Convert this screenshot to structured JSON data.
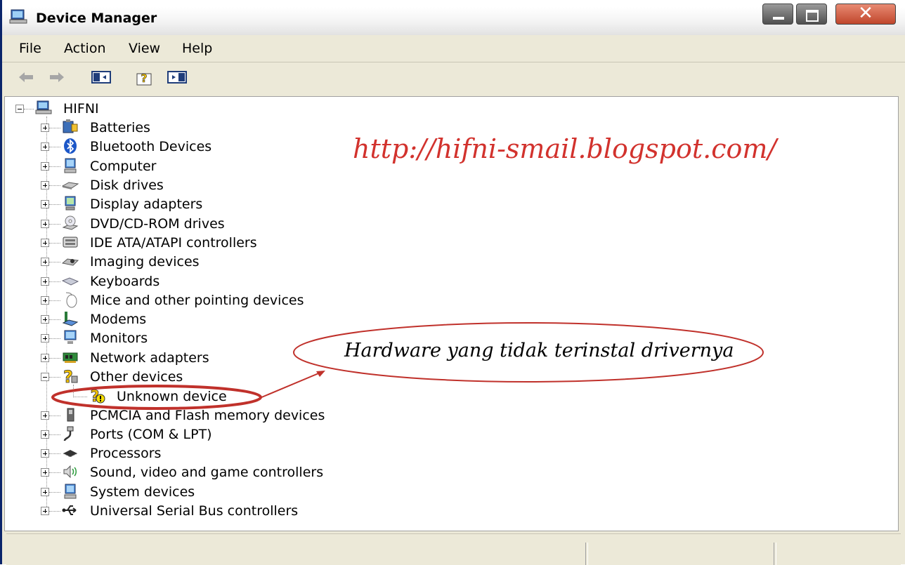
{
  "window": {
    "title": "Device Manager",
    "close_glyph": "✕"
  },
  "menu": [
    "File",
    "Action",
    "View",
    "Help"
  ],
  "toolbar": {
    "icons": [
      "back-arrow-icon",
      "forward-arrow-icon",
      "console-tree-icon",
      "help-icon",
      "action-pane-icon"
    ]
  },
  "tree": {
    "root": "HIFNI",
    "categories": [
      "Batteries",
      "Bluetooth Devices",
      "Computer",
      "Disk drives",
      "Display adapters",
      "DVD/CD-ROM drives",
      "IDE ATA/ATAPI controllers",
      "Imaging devices",
      "Keyboards",
      "Mice and other pointing devices",
      "Modems",
      "Monitors",
      "Network adapters",
      "Other devices",
      "Unknown device",
      "PCMCIA and Flash memory devices",
      "Ports (COM & LPT)",
      "Processors",
      "Sound, video and game controllers",
      "System devices",
      "Universal Serial Bus controllers"
    ]
  },
  "annotations": {
    "url": "http://hifni-smail.blogspot.com/",
    "note": "Hardware yang tidak terinstal drivernya",
    "highlight_color": "#c0312b"
  }
}
